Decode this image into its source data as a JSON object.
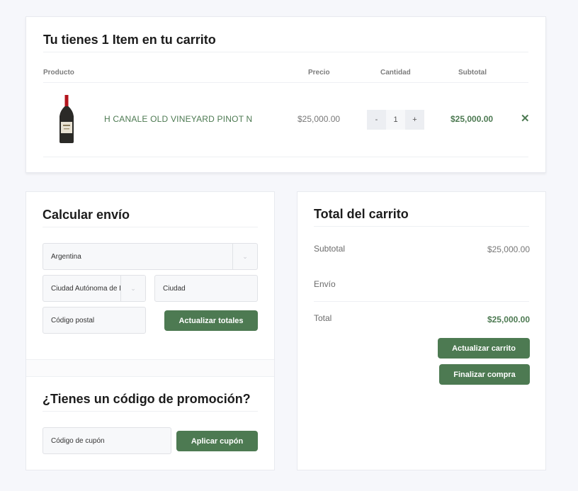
{
  "cart": {
    "title": "Tu tienes 1 Item en tu carrito",
    "columns": {
      "product": "Producto",
      "price": "Precio",
      "quantity": "Cantidad",
      "subtotal": "Subtotal"
    },
    "item": {
      "name": "H CANALE OLD VINEYARD PINOT N",
      "price": "$25,000.00",
      "qty_minus": "-",
      "quantity": "1",
      "qty_plus": "+",
      "subtotal": "$25,000.00",
      "remove": "✕"
    }
  },
  "shipping": {
    "title": "Calcular envío",
    "country": "Argentina",
    "state": "Ciudad Autónoma de Buenos Aires",
    "city_placeholder": "Ciudad",
    "postal_placeholder": "Código postal",
    "update_totals": "Actualizar totales"
  },
  "promo": {
    "title": "¿Tienes un código de promoción?",
    "coupon_placeholder": "Código de cupón",
    "apply": "Aplicar cupón"
  },
  "totals": {
    "title": "Total del carrito",
    "subtotal_label": "Subtotal",
    "subtotal_value": "$25,000.00",
    "shipping_label": "Envío",
    "total_label": "Total",
    "total_value": "$25,000.00",
    "update_cart": "Actualizar carrito",
    "checkout": "Finalizar compra"
  },
  "colors": {
    "accent": "#4d7a52",
    "background": "#f6f7fb"
  }
}
